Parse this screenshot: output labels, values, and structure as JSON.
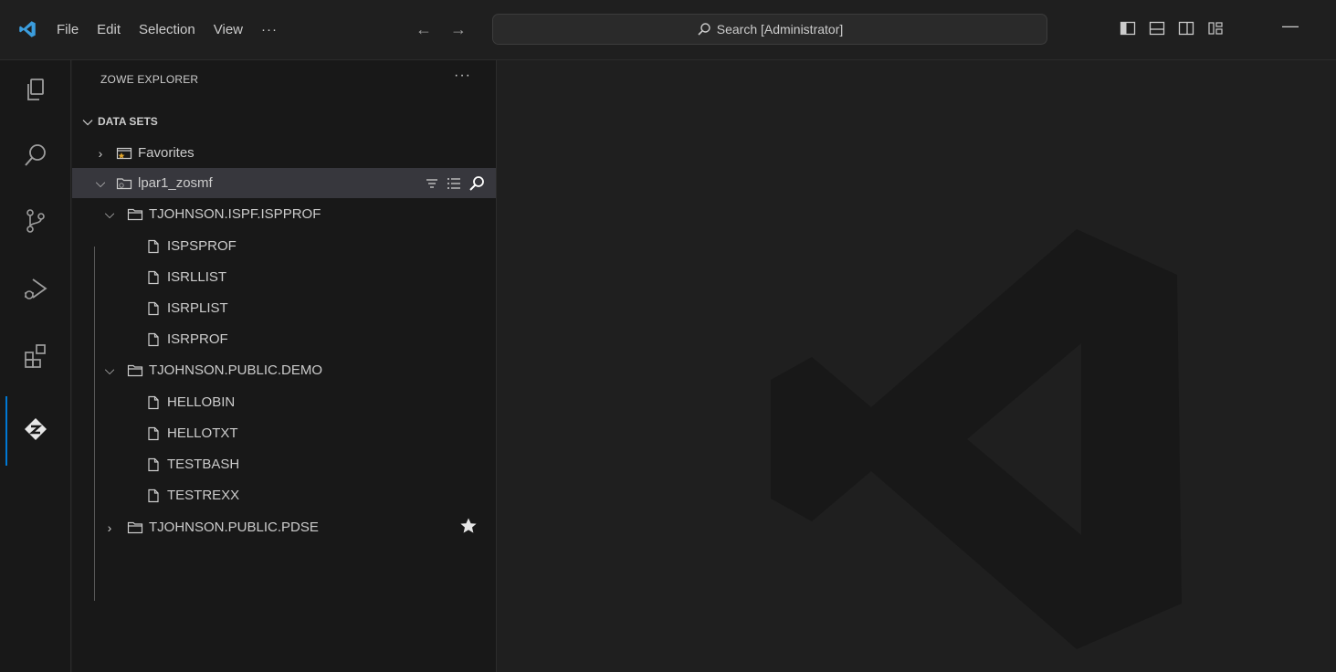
{
  "titlebar": {
    "menu": [
      "File",
      "Edit",
      "Selection",
      "View",
      "···"
    ],
    "back": "←",
    "forward": "→",
    "search_text": "Search [Administrator]",
    "minimize": "—"
  },
  "activity": {
    "icons": [
      "explorer-icon",
      "search-icon",
      "source-control-icon",
      "run-debug-icon",
      "extensions-icon",
      "zowe-icon"
    ],
    "active": "zowe-icon"
  },
  "sidebar": {
    "title": "ZOWE EXPLORER",
    "more": "···",
    "section": "DATA SETS",
    "tree": {
      "favorites": "Favorites",
      "profile": "lpar1_zosmf",
      "datasets": [
        {
          "name": "TJOHNSON.ISPF.ISPPROF",
          "members": [
            "ISPSPROF",
            "ISRLLIST",
            "ISRPLIST",
            "ISRPROF"
          ]
        },
        {
          "name": "TJOHNSON.PUBLIC.DEMO",
          "members": [
            "HELLOBIN",
            "HELLOTXT",
            "TESTBASH",
            "TESTREXX"
          ]
        },
        {
          "name": "TJOHNSON.PUBLIC.PDSE"
        }
      ]
    }
  },
  "colors": {
    "background": "#1f1f1f",
    "sidebar": "#181818",
    "selected_row": "#37373d",
    "accent": "#0078d4",
    "vscode_blue": "#3b9ddd"
  }
}
